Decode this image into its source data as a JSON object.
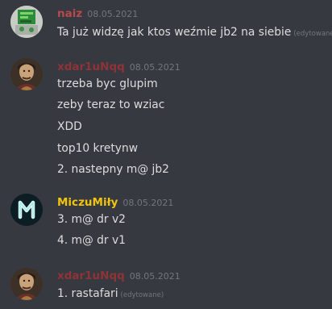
{
  "colors": {
    "background": "#36393f",
    "text": "#dcddde",
    "muted": "#72767d",
    "user_naiz": "#b84a4e",
    "user_xdar": "#8e3337",
    "user_miczu": "#f1c40f"
  },
  "messages": [
    {
      "username": "naiz",
      "timestamp": "08.05.2021",
      "avatar_icon": "green-sticker-avatar-icon",
      "lines": [
        {
          "text": "Ta już widzę jak ktos weźmie jb2 na siebie",
          "edited": "(edytowane)"
        }
      ]
    },
    {
      "username": "xdar1uNqq",
      "timestamp": "08.05.2021",
      "avatar_icon": "portrait-avatar-icon",
      "lines": [
        {
          "text": "trzeba byc glupim"
        },
        {
          "text": "zeby teraz to wziac"
        },
        {
          "text": "XDD"
        },
        {
          "text": "top10 kretynw"
        },
        {
          "text": "2. nastepny m@ jb2"
        }
      ]
    },
    {
      "username": "MiczuMiły",
      "timestamp": "08.05.2021",
      "avatar_icon": "m-letter-avatar-icon",
      "avatar_letter": "M",
      "lines": [
        {
          "text": "3. m@ dr v2"
        },
        {
          "text": "4. m@ dr v1"
        }
      ]
    },
    {
      "username": "xdar1uNqq",
      "timestamp": "08.05.2021",
      "avatar_icon": "portrait-avatar-icon",
      "lines": [
        {
          "text": "1. rastafari",
          "edited": "(edytowane)"
        }
      ]
    }
  ]
}
